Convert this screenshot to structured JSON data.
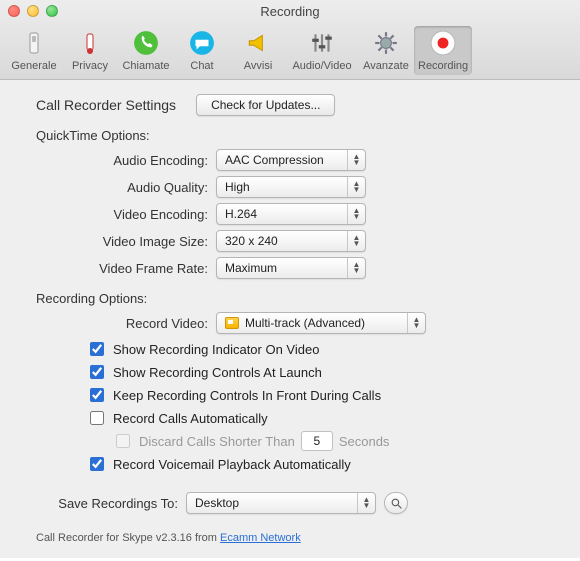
{
  "window": {
    "title": "Recording"
  },
  "toolbar": {
    "items": [
      {
        "label": "Generale"
      },
      {
        "label": "Privacy"
      },
      {
        "label": "Chiamate"
      },
      {
        "label": "Chat"
      },
      {
        "label": "Avvisi"
      },
      {
        "label": "Audio/Video"
      },
      {
        "label": "Avanzate"
      },
      {
        "label": "Recording"
      }
    ]
  },
  "header": {
    "title": "Call Recorder Settings",
    "updates_btn": "Check for Updates..."
  },
  "quicktime": {
    "section": "QuickTime Options:",
    "audio_encoding_label": "Audio Encoding:",
    "audio_encoding_value": "AAC Compression",
    "audio_quality_label": "Audio Quality:",
    "audio_quality_value": "High",
    "video_encoding_label": "Video Encoding:",
    "video_encoding_value": "H.264",
    "video_image_size_label": "Video Image Size:",
    "video_image_size_value": "320 x 240",
    "video_frame_rate_label": "Video Frame Rate:",
    "video_frame_rate_value": "Maximum"
  },
  "recording": {
    "section": "Recording Options:",
    "record_video_label": "Record Video:",
    "record_video_value": "Multi-track (Advanced)",
    "chk_indicator": "Show Recording Indicator On Video",
    "chk_controls_launch": "Show Recording Controls At Launch",
    "chk_keep_front": "Keep Recording Controls In Front During Calls",
    "chk_auto_record": "Record Calls Automatically",
    "chk_discard_prefix": "Discard Calls Shorter Than",
    "chk_discard_value": "5",
    "chk_discard_suffix": "Seconds",
    "chk_voicemail": "Record Voicemail Playback Automatically"
  },
  "save": {
    "label": "Save Recordings To:",
    "value": "Desktop"
  },
  "footer": {
    "prefix": "Call Recorder for Skype v2.3.16 from ",
    "link": "Ecamm Network"
  }
}
